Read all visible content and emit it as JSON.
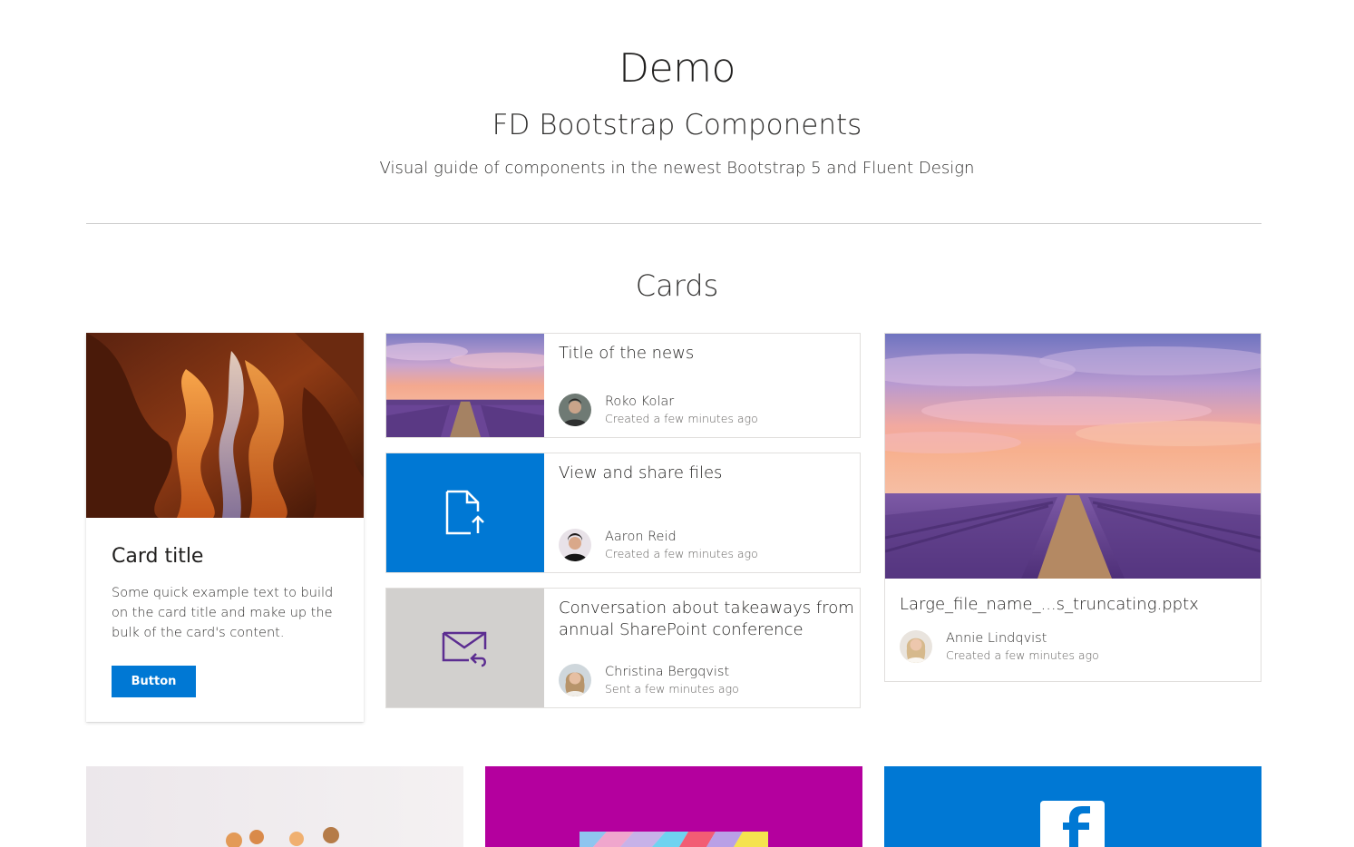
{
  "header": {
    "title": "Demo",
    "subtitle": "FD Bootstrap Components",
    "lead": "Visual guide of components in the newest Bootstrap 5 and Fluent Design"
  },
  "section": {
    "title": "Cards"
  },
  "card_basic": {
    "image": "canyon-photo",
    "title": "Card title",
    "text": "Some quick example text to build on the card title and make up the bulk of the card's content.",
    "button_label": "Button"
  },
  "news_cards": [
    {
      "thumbnail": "lavender-field-photo",
      "title": "Title of the news",
      "author": "Roko Kolar",
      "meta": "Created a few minutes ago"
    },
    {
      "thumbnail": "file-upload-icon",
      "thumbnail_bg": "#0078d4",
      "title": "View and share files",
      "author": "Aaron Reid",
      "meta": "Created a few minutes ago"
    },
    {
      "thumbnail": "mail-reply-icon",
      "thumbnail_bg": "#d2d0ce",
      "title": "Conversation about takeaways from annual SharePoint conference",
      "author": "Christina Bergqvist",
      "meta": "Sent a few minutes ago"
    }
  ],
  "file_card": {
    "image": "lavender-field-photo",
    "title": "Large_file_name_...s_truncating.pptx",
    "author": "Annie Lindqvist",
    "meta": "Created a few minutes ago"
  },
  "bottom_cards": [
    {
      "image": "people-photo"
    },
    {
      "image": "colorful-pattern",
      "bg": "#b4009e"
    },
    {
      "image": "facebook-logo",
      "bg": "#0078d4"
    }
  ],
  "colors": {
    "accent": "#0078d4",
    "magenta": "#b4009e",
    "grey_tile": "#d2d0ce",
    "mail_icon": "#5c2d91"
  }
}
